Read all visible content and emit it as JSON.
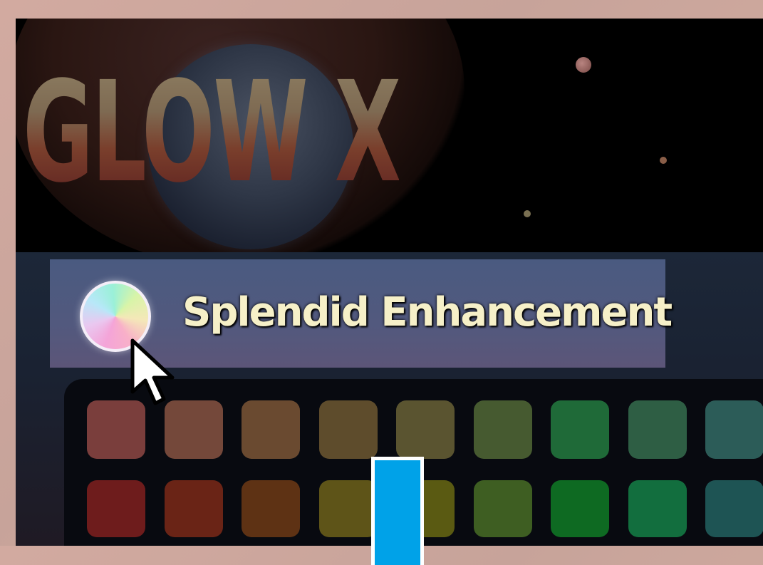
{
  "app": {
    "logo_text": "GLOW X"
  },
  "profile": {
    "label": "Splendid Enhancement",
    "icon": "rainbow-orb-icon"
  },
  "palette": {
    "row1": [
      "#7a3e3c",
      "#74483a",
      "#6a4a30",
      "#5e4c2c",
      "#5a5430",
      "#465a30",
      "#1f6a38",
      "#2e5e44",
      "#2c5c58"
    ],
    "row2": [
      "#6e1c1c",
      "#6a2416",
      "#5e3214",
      "#5e5418",
      "#5a5a12",
      "#3e5e22",
      "#0e6a22",
      "#126e3e",
      "#1e5454"
    ]
  },
  "colors": {
    "accent_marker": "#00a2e8",
    "profile_text": "#f6f0c8"
  }
}
